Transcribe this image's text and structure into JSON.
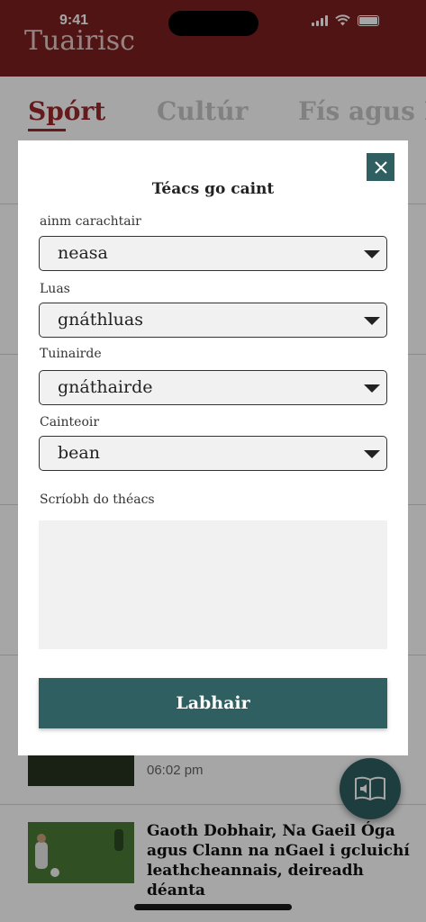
{
  "status_bar": {
    "time": "9:41"
  },
  "app": {
    "logo": "Tuairisc"
  },
  "tabs": [
    {
      "label": "Spórt"
    },
    {
      "label": "Cultúr"
    },
    {
      "label": "Fís agus F"
    }
  ],
  "feed": {
    "partial_meta": "06:02 pm",
    "article_title": "Gaoth Dobhair, Na Gaeil Óga agus Clann na nGael i gcluichí leathcheannais, deireadh déanta"
  },
  "modal": {
    "title": "Téacs go caint",
    "close_icon": "close-icon",
    "fields": [
      {
        "label": "ainm carachtair",
        "value": "neasa"
      },
      {
        "label": "Luas",
        "value": "gnáthluas"
      },
      {
        "label": "Tuinairde",
        "value": "gnáthairde"
      },
      {
        "label": "Cainteoir",
        "value": "bean"
      }
    ],
    "text_label": "Scríobh do théacs",
    "text_value": "",
    "speak_button": "Labhair"
  },
  "colors": {
    "brand": "#7b2020",
    "accent": "#2f5f60",
    "active_tab": "#9b2a2a"
  },
  "icons": [
    "signal-icon",
    "wifi-icon",
    "battery-icon",
    "close-icon",
    "dropdown-arrow-icon",
    "audio-book-icon"
  ]
}
